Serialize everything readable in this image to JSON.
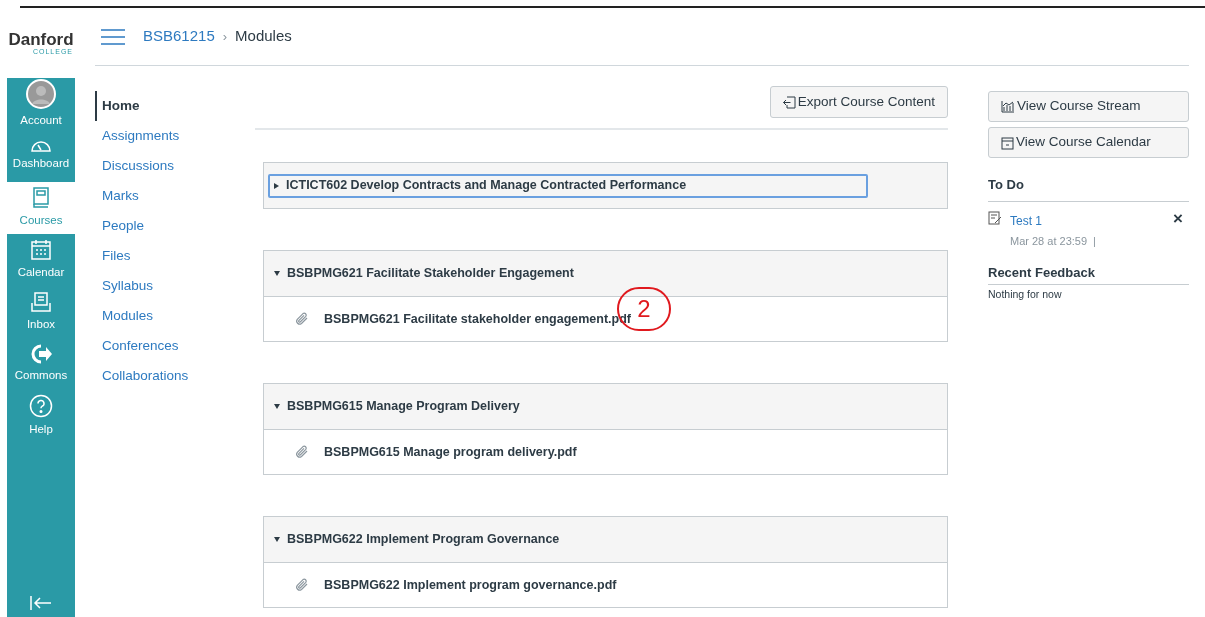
{
  "logo": {
    "name": "Danford",
    "tagline": "COLLEGE"
  },
  "global_nav": [
    {
      "kind": "account",
      "label": "Account",
      "selected": false
    },
    {
      "kind": "dashboard",
      "label": "Dashboard",
      "selected": false
    },
    {
      "kind": "courses",
      "label": "Courses",
      "selected": true
    },
    {
      "kind": "calendar",
      "label": "Calendar",
      "selected": false
    },
    {
      "kind": "inbox",
      "label": "Inbox",
      "selected": false
    },
    {
      "kind": "commons",
      "label": "Commons",
      "selected": false
    },
    {
      "kind": "help",
      "label": "Help",
      "selected": false
    }
  ],
  "breadcrumb": {
    "course": "BSB61215",
    "separator": "›",
    "page": "Modules"
  },
  "course_nav": [
    {
      "label": "Home",
      "selected": true
    },
    {
      "label": "Assignments",
      "selected": false
    },
    {
      "label": "Discussions",
      "selected": false
    },
    {
      "label": "Marks",
      "selected": false
    },
    {
      "label": "People",
      "selected": false
    },
    {
      "label": "Files",
      "selected": false
    },
    {
      "label": "Syllabus",
      "selected": false
    },
    {
      "label": "Modules",
      "selected": false
    },
    {
      "label": "Conferences",
      "selected": false
    },
    {
      "label": "Collaborations",
      "selected": false
    }
  ],
  "export_button": "Export Course Content",
  "modules": [
    {
      "title": "ICTICT602 Develop Contracts and Manage Contracted Performance",
      "expanded": false,
      "focused": true
    },
    {
      "title": "BSBPMG621 Facilitate Stakeholder Engagement",
      "expanded": true,
      "focused": false,
      "items": [
        {
          "title": "BSBPMG621 Facilitate stakeholder engagement.pdf"
        }
      ]
    },
    {
      "title": "BSBPMG615 Manage Program Delivery",
      "expanded": true,
      "focused": false,
      "items": [
        {
          "title": "BSBPMG615 Manage program delivery.pdf"
        }
      ]
    },
    {
      "title": "BSBPMG622 Implement Program Governance",
      "expanded": true,
      "focused": false,
      "items": [
        {
          "title": "BSBPMG622 Implement program governance.pdf"
        }
      ]
    }
  ],
  "annotation": {
    "label": "2"
  },
  "sidebar": {
    "buttons": [
      {
        "kind": "stream",
        "label": "View Course Stream"
      },
      {
        "kind": "calendar",
        "label": "View Course Calendar"
      }
    ],
    "todo_heading": "To Do",
    "todo": [
      {
        "title": "Test 1",
        "due": "Mar 28 at 23:59",
        "separator": "|",
        "close": "×"
      }
    ],
    "feedback_heading": "Recent Feedback",
    "feedback_empty": "Nothing for now"
  }
}
